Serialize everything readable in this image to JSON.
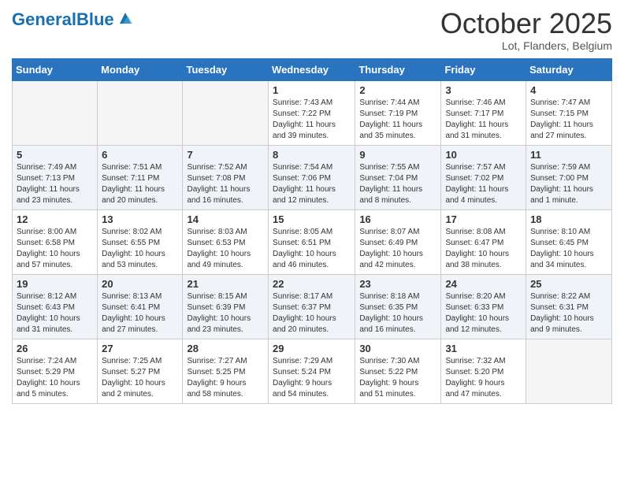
{
  "header": {
    "logo_general": "General",
    "logo_blue": "Blue",
    "month": "October 2025",
    "location": "Lot, Flanders, Belgium"
  },
  "days_of_week": [
    "Sunday",
    "Monday",
    "Tuesday",
    "Wednesday",
    "Thursday",
    "Friday",
    "Saturday"
  ],
  "weeks": [
    [
      {
        "day": "",
        "info": ""
      },
      {
        "day": "",
        "info": ""
      },
      {
        "day": "",
        "info": ""
      },
      {
        "day": "1",
        "info": "Sunrise: 7:43 AM\nSunset: 7:22 PM\nDaylight: 11 hours\nand 39 minutes."
      },
      {
        "day": "2",
        "info": "Sunrise: 7:44 AM\nSunset: 7:19 PM\nDaylight: 11 hours\nand 35 minutes."
      },
      {
        "day": "3",
        "info": "Sunrise: 7:46 AM\nSunset: 7:17 PM\nDaylight: 11 hours\nand 31 minutes."
      },
      {
        "day": "4",
        "info": "Sunrise: 7:47 AM\nSunset: 7:15 PM\nDaylight: 11 hours\nand 27 minutes."
      }
    ],
    [
      {
        "day": "5",
        "info": "Sunrise: 7:49 AM\nSunset: 7:13 PM\nDaylight: 11 hours\nand 23 minutes."
      },
      {
        "day": "6",
        "info": "Sunrise: 7:51 AM\nSunset: 7:11 PM\nDaylight: 11 hours\nand 20 minutes."
      },
      {
        "day": "7",
        "info": "Sunrise: 7:52 AM\nSunset: 7:08 PM\nDaylight: 11 hours\nand 16 minutes."
      },
      {
        "day": "8",
        "info": "Sunrise: 7:54 AM\nSunset: 7:06 PM\nDaylight: 11 hours\nand 12 minutes."
      },
      {
        "day": "9",
        "info": "Sunrise: 7:55 AM\nSunset: 7:04 PM\nDaylight: 11 hours\nand 8 minutes."
      },
      {
        "day": "10",
        "info": "Sunrise: 7:57 AM\nSunset: 7:02 PM\nDaylight: 11 hours\nand 4 minutes."
      },
      {
        "day": "11",
        "info": "Sunrise: 7:59 AM\nSunset: 7:00 PM\nDaylight: 11 hours\nand 1 minute."
      }
    ],
    [
      {
        "day": "12",
        "info": "Sunrise: 8:00 AM\nSunset: 6:58 PM\nDaylight: 10 hours\nand 57 minutes."
      },
      {
        "day": "13",
        "info": "Sunrise: 8:02 AM\nSunset: 6:55 PM\nDaylight: 10 hours\nand 53 minutes."
      },
      {
        "day": "14",
        "info": "Sunrise: 8:03 AM\nSunset: 6:53 PM\nDaylight: 10 hours\nand 49 minutes."
      },
      {
        "day": "15",
        "info": "Sunrise: 8:05 AM\nSunset: 6:51 PM\nDaylight: 10 hours\nand 46 minutes."
      },
      {
        "day": "16",
        "info": "Sunrise: 8:07 AM\nSunset: 6:49 PM\nDaylight: 10 hours\nand 42 minutes."
      },
      {
        "day": "17",
        "info": "Sunrise: 8:08 AM\nSunset: 6:47 PM\nDaylight: 10 hours\nand 38 minutes."
      },
      {
        "day": "18",
        "info": "Sunrise: 8:10 AM\nSunset: 6:45 PM\nDaylight: 10 hours\nand 34 minutes."
      }
    ],
    [
      {
        "day": "19",
        "info": "Sunrise: 8:12 AM\nSunset: 6:43 PM\nDaylight: 10 hours\nand 31 minutes."
      },
      {
        "day": "20",
        "info": "Sunrise: 8:13 AM\nSunset: 6:41 PM\nDaylight: 10 hours\nand 27 minutes."
      },
      {
        "day": "21",
        "info": "Sunrise: 8:15 AM\nSunset: 6:39 PM\nDaylight: 10 hours\nand 23 minutes."
      },
      {
        "day": "22",
        "info": "Sunrise: 8:17 AM\nSunset: 6:37 PM\nDaylight: 10 hours\nand 20 minutes."
      },
      {
        "day": "23",
        "info": "Sunrise: 8:18 AM\nSunset: 6:35 PM\nDaylight: 10 hours\nand 16 minutes."
      },
      {
        "day": "24",
        "info": "Sunrise: 8:20 AM\nSunset: 6:33 PM\nDaylight: 10 hours\nand 12 minutes."
      },
      {
        "day": "25",
        "info": "Sunrise: 8:22 AM\nSunset: 6:31 PM\nDaylight: 10 hours\nand 9 minutes."
      }
    ],
    [
      {
        "day": "26",
        "info": "Sunrise: 7:24 AM\nSunset: 5:29 PM\nDaylight: 10 hours\nand 5 minutes."
      },
      {
        "day": "27",
        "info": "Sunrise: 7:25 AM\nSunset: 5:27 PM\nDaylight: 10 hours\nand 2 minutes."
      },
      {
        "day": "28",
        "info": "Sunrise: 7:27 AM\nSunset: 5:25 PM\nDaylight: 9 hours\nand 58 minutes."
      },
      {
        "day": "29",
        "info": "Sunrise: 7:29 AM\nSunset: 5:24 PM\nDaylight: 9 hours\nand 54 minutes."
      },
      {
        "day": "30",
        "info": "Sunrise: 7:30 AM\nSunset: 5:22 PM\nDaylight: 9 hours\nand 51 minutes."
      },
      {
        "day": "31",
        "info": "Sunrise: 7:32 AM\nSunset: 5:20 PM\nDaylight: 9 hours\nand 47 minutes."
      },
      {
        "day": "",
        "info": ""
      }
    ]
  ]
}
